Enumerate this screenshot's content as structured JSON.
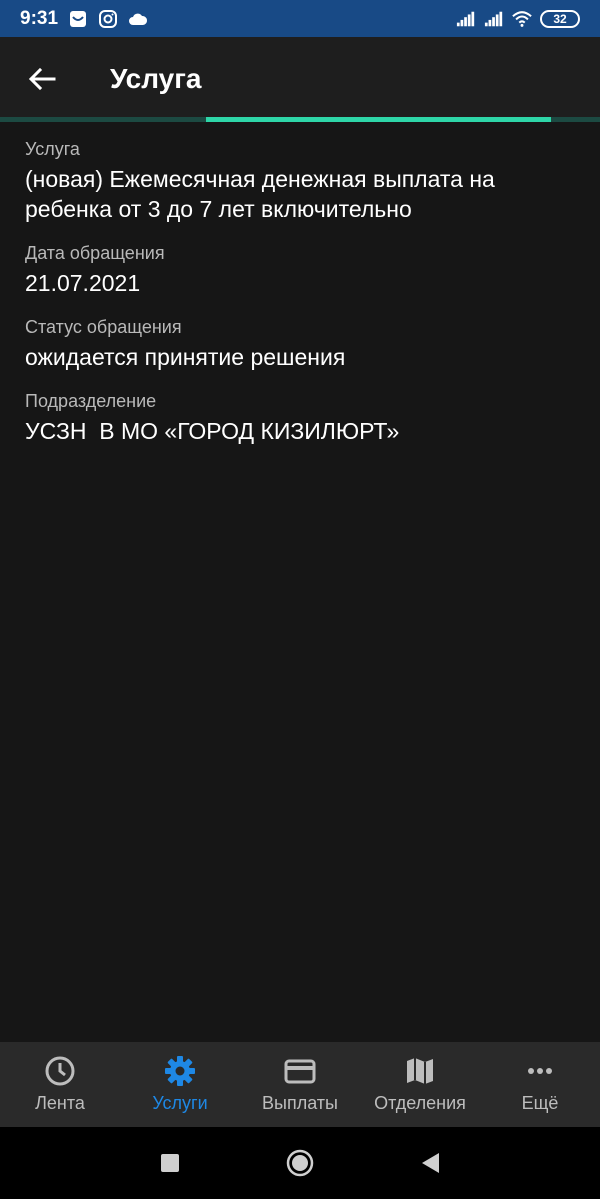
{
  "status_bar": {
    "time": "9:31",
    "battery": "32",
    "icons": [
      "notification-icon",
      "instagram-icon",
      "cloud-icon",
      "signal-icon",
      "signal-icon",
      "wifi-icon",
      "battery-icon"
    ]
  },
  "app_bar": {
    "title": "Услуга",
    "progress": 0.575,
    "colors": {
      "background": "#1e1e1e",
      "accent": "#2ed6a8"
    }
  },
  "fields": [
    {
      "label": "Услуга",
      "value": "(новая) Ежемесячная денежная выплата на ребенка от 3 до 7 лет включительно"
    },
    {
      "label": "Дата обращения",
      "value": "21.07.2021"
    },
    {
      "label": "Статус обращения",
      "value": "ожидается принятие решения"
    },
    {
      "label": "Подразделение",
      "value": "УСЗН  В МО «ГОРОД КИЗИЛЮРТ»"
    }
  ],
  "bottom_nav": {
    "items": [
      {
        "label": "Лента",
        "icon": "clock-icon",
        "active": false
      },
      {
        "label": "Услуги",
        "icon": "gear-icon",
        "active": true
      },
      {
        "label": "Выплаты",
        "icon": "card-icon",
        "active": false
      },
      {
        "label": "Отделения",
        "icon": "map-icon",
        "active": false
      },
      {
        "label": "Ещё",
        "icon": "more-icon",
        "active": false
      }
    ],
    "active_color": "#1e88e5",
    "inactive_color": "#bdbdbd"
  },
  "system_nav": {
    "buttons": [
      "recents-icon",
      "home-icon",
      "back-icon"
    ]
  }
}
